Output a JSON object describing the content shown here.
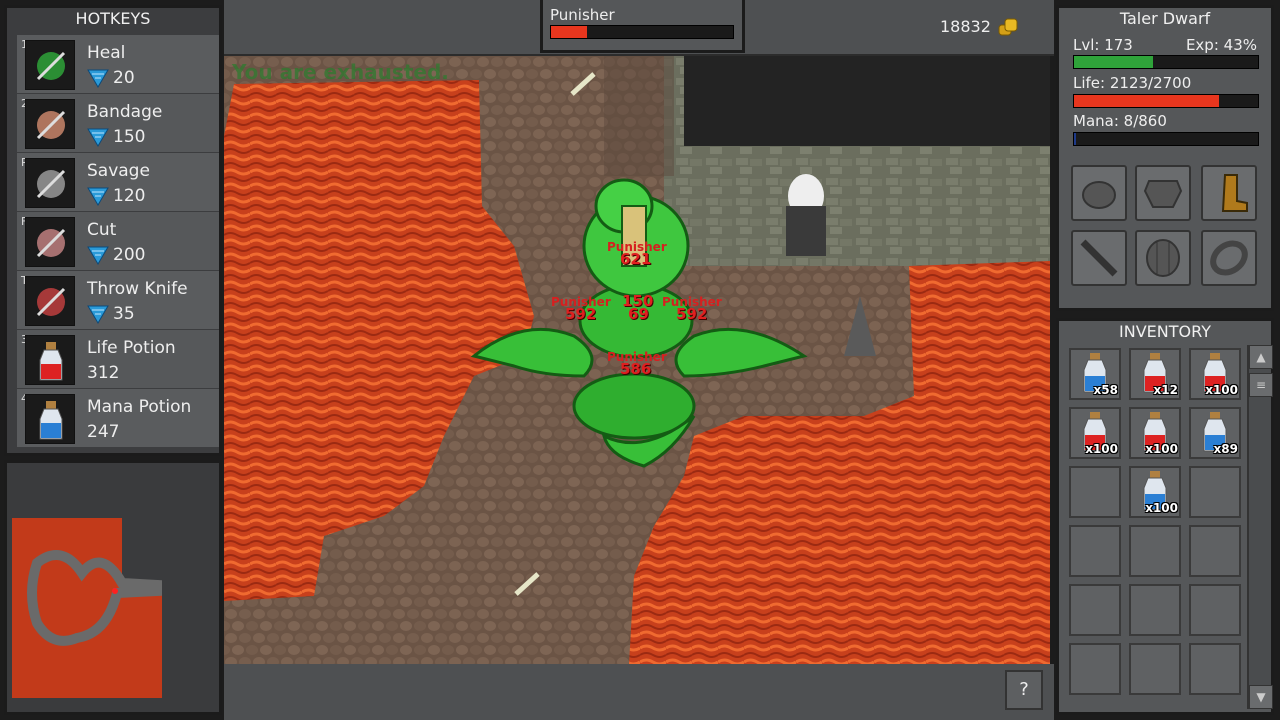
{
  "hotkeys": {
    "title": "HOTKEYS",
    "items": [
      {
        "key": "1",
        "name": "Heal",
        "cost": "20",
        "icon": "heal-icon"
      },
      {
        "key": "2",
        "name": "Bandage",
        "cost": "150",
        "icon": "bandage-icon"
      },
      {
        "key": "R",
        "name": "Savage",
        "cost": "120",
        "icon": "savage-icon"
      },
      {
        "key": "F",
        "name": "Cut",
        "cost": "200",
        "icon": "cut-icon"
      },
      {
        "key": "T",
        "name": "Throw Knife",
        "cost": "35",
        "icon": "throw-knife-icon"
      },
      {
        "key": "3",
        "name": "Life Potion",
        "cost": "312",
        "icon": "life-potion-icon"
      },
      {
        "key": "4",
        "name": "Mana Potion",
        "cost": "247",
        "icon": "mana-potion-icon"
      }
    ]
  },
  "target": {
    "name": "Punisher",
    "health_fraction": 0.2
  },
  "gold": "18832",
  "message": "You are exhausted.",
  "combat": {
    "monster": "Punisher",
    "damage": [
      "621",
      "592",
      "150",
      "69",
      "592",
      "586"
    ]
  },
  "character": {
    "name": "Taler Dwarf",
    "level_label": "Lvl: 173",
    "exp_label": "Exp: 43%",
    "exp_fraction": 0.43,
    "life_label": "Life: 2123/2700",
    "life_fraction": 0.786,
    "mana_label": "Mana: 8/860",
    "mana_fraction": 0.009,
    "colors": {
      "exp": "#2fa33a",
      "life": "#e8361e",
      "mana": "#1e3a8a"
    }
  },
  "equipment": [
    "helmet-slot",
    "armor-slot",
    "boots-slot",
    "weapon-slot",
    "shield-slot",
    "ring-slot"
  ],
  "inventory": {
    "title": "INVENTORY",
    "slots": [
      {
        "item": "mana-potion",
        "qty": "x58"
      },
      {
        "item": "life-potion",
        "qty": "x12"
      },
      {
        "item": "life-potion",
        "qty": "x100"
      },
      {
        "item": "life-potion",
        "qty": "x100"
      },
      {
        "item": "life-potion",
        "qty": "x100"
      },
      {
        "item": "mana-potion",
        "qty": "x89"
      },
      {
        "item": "",
        "qty": ""
      },
      {
        "item": "mana-potion",
        "qty": "x100"
      },
      {
        "item": "",
        "qty": ""
      },
      {
        "item": "",
        "qty": ""
      },
      {
        "item": "",
        "qty": ""
      },
      {
        "item": "",
        "qty": ""
      },
      {
        "item": "",
        "qty": ""
      },
      {
        "item": "",
        "qty": ""
      },
      {
        "item": "",
        "qty": ""
      },
      {
        "item": "",
        "qty": ""
      },
      {
        "item": "",
        "qty": ""
      },
      {
        "item": "",
        "qty": ""
      }
    ]
  },
  "help_label": "?"
}
